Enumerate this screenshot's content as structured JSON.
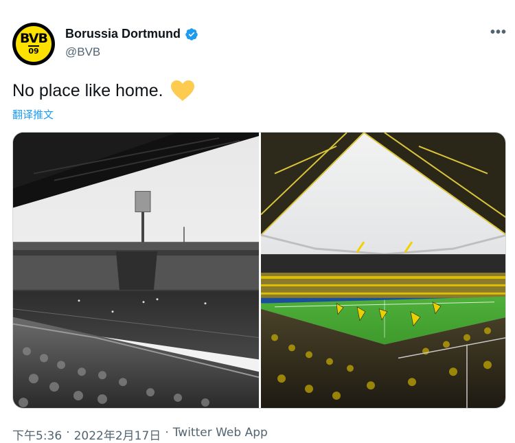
{
  "account": {
    "name": "Borussia Dortmund",
    "handle": "@BVB",
    "avatar_text": "BVB",
    "avatar_sub": "09"
  },
  "icons": {
    "verified": "verified-badge-icon",
    "more": "more-options-icon",
    "heart": "yellow-heart-emoji"
  },
  "tweet": {
    "text": "No place like home.",
    "translate_label": "翻译推文"
  },
  "media": {
    "left": "black-and-white historic stadium photo",
    "right": "color modern stadium photo"
  },
  "footer": {
    "time": "下午5:36",
    "separator1": "·",
    "date": "2022年2月17日",
    "separator2": "·",
    "source": "Twitter Web App"
  },
  "colors": {
    "brand_yellow": "#fde100",
    "link_blue": "#1d9bf0",
    "secondary_text": "#536471"
  }
}
